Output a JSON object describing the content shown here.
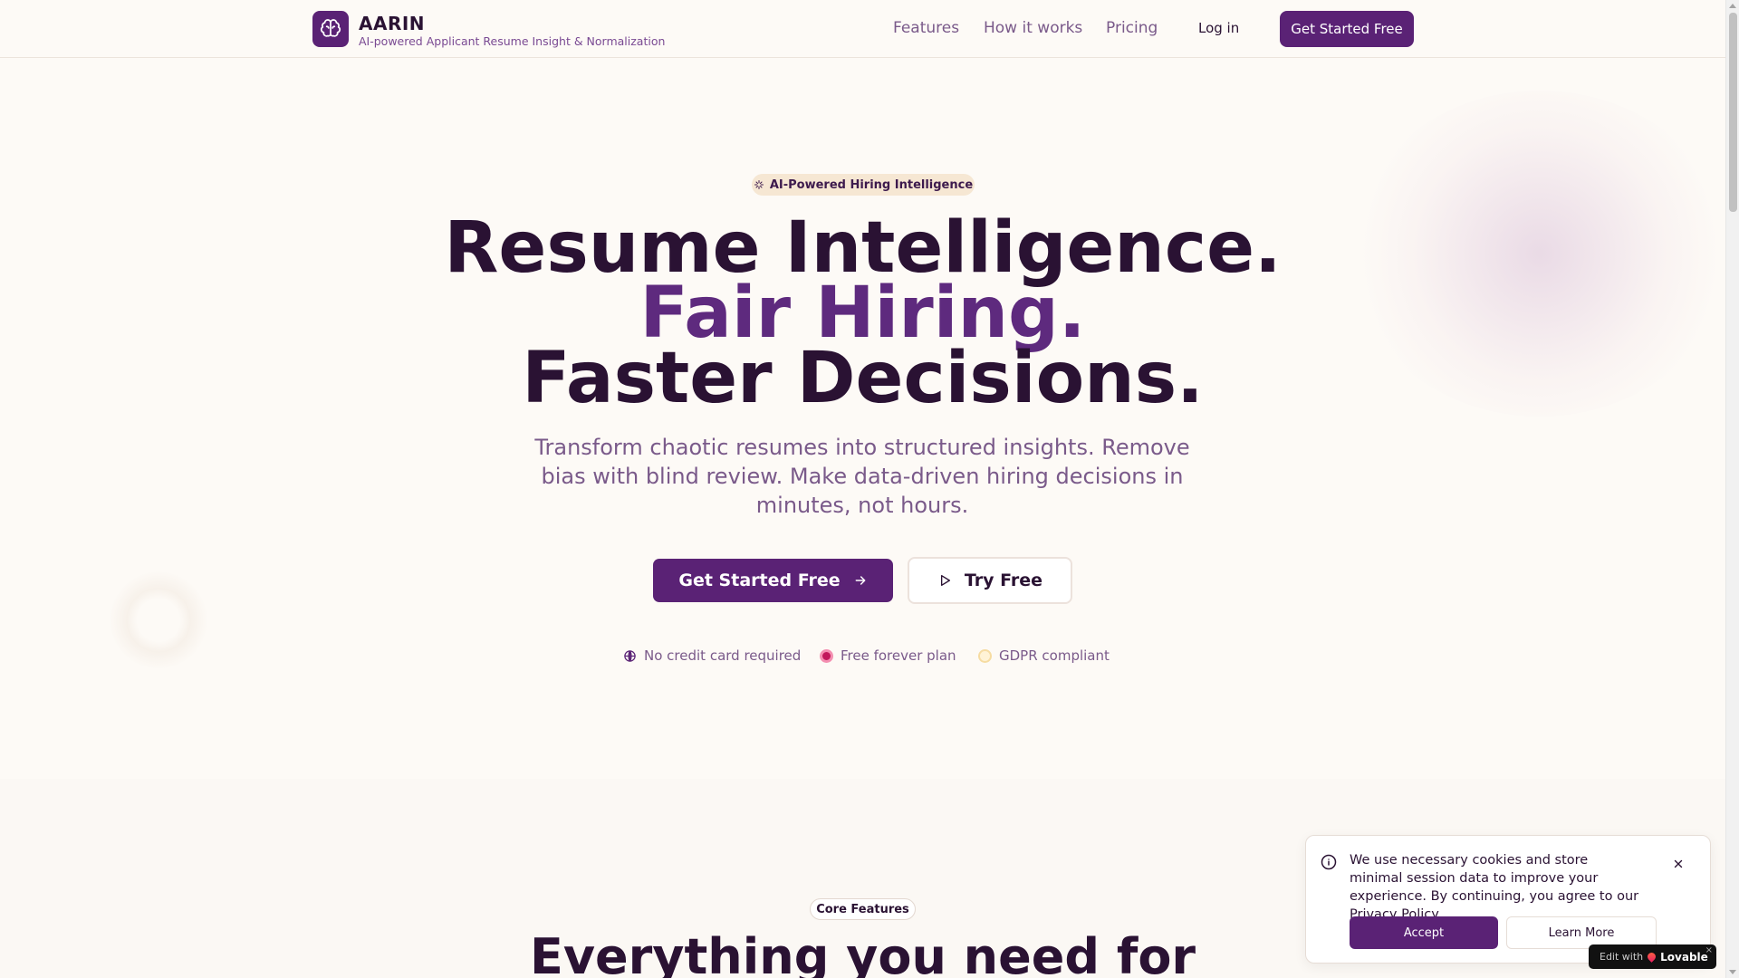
{
  "header": {
    "brand_name": "AARIN",
    "brand_tagline": "AI-powered Applicant Resume Insight & Normalization",
    "nav": [
      "Features",
      "How it works",
      "Pricing"
    ],
    "login": "Log in",
    "cta": "Get Started Free"
  },
  "hero": {
    "badge": "AI-Powered Hiring Intelligence",
    "headline_1": "Resume Intelligence.",
    "headline_2": "Fair Hiring.",
    "headline_3": "Faster Decisions.",
    "subtitle": "Transform chaotic resumes into structured insights. Remove bias with blind review. Make data-driven hiring decisions in minutes, not hours.",
    "primary_cta": "Get Started Free",
    "secondary_cta": "Try Free",
    "features": [
      "No credit card required",
      "Free forever plan",
      "GDPR compliant"
    ]
  },
  "section": {
    "badge": "Core Features",
    "heading": "Everything you need for"
  },
  "cookie": {
    "message": "We use necessary cookies and store minimal session data to improve your experience. By continuing, you agree to our Privacy Policy.",
    "accept": "Accept",
    "learn_more": "Learn More"
  },
  "lovable": {
    "prefix": "Edit with",
    "brand": "Lovable",
    "close": "×"
  },
  "colors": {
    "brand_primary": "#5a2275",
    "accent_text": "#5e2a7e",
    "background": "#fdfaf6",
    "badge_bg": "#f6e7d3"
  }
}
